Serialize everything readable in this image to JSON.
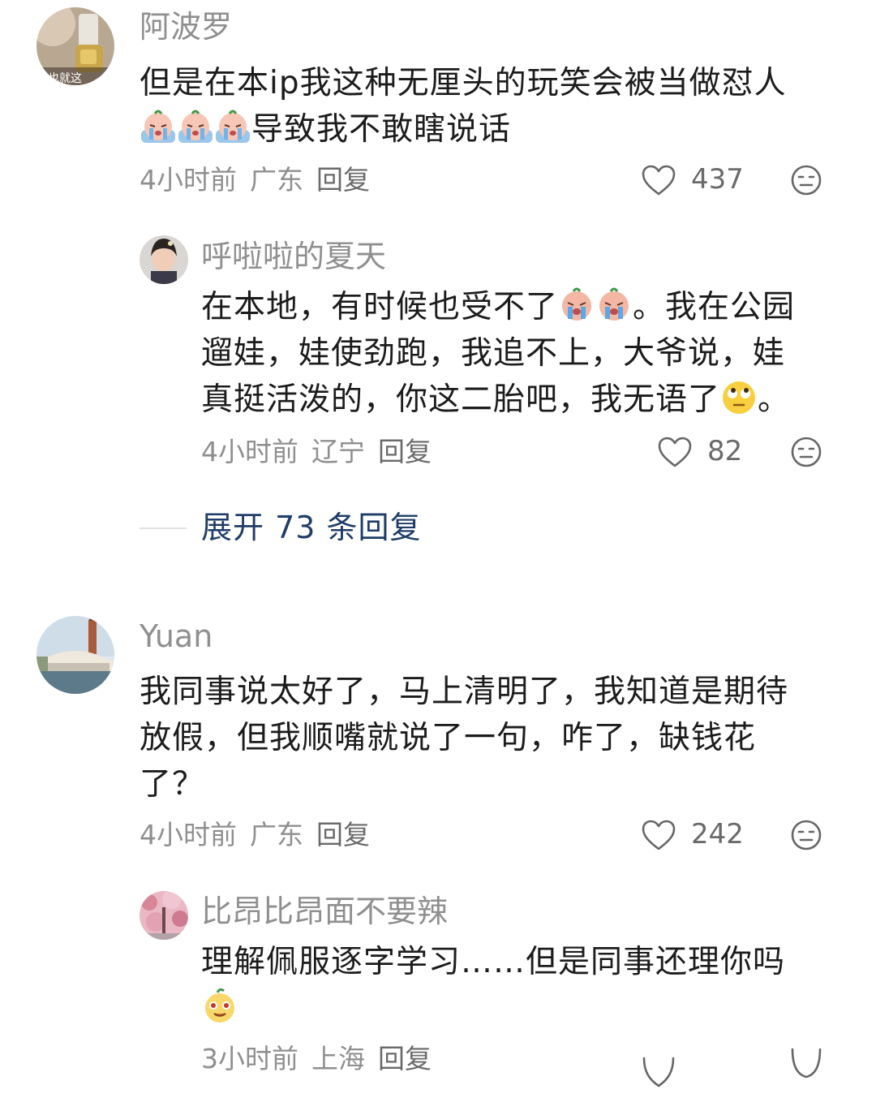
{
  "comments": [
    {
      "username": "阿波罗",
      "avatar_text": "也就这",
      "content_line1": "但是在本ip我这种无厘头的玩笑会被当做怼人",
      "content_line2": "导致我不敢瞎说话",
      "time": "4小时前",
      "location": "广东",
      "reply_label": "回复",
      "likes": "437"
    },
    {
      "username": "呼啦啦的夏天",
      "content_line1a": "在本地，有时候也受不了",
      "content_line1b": "。我在公园",
      "content_line2": "遛娃，娃使劲跑，我追不上，大爷说，娃",
      "content_line3a": "真挺活泼的，你这二胎吧，我无语了",
      "content_line3b": "。",
      "time": "4小时前",
      "location": "辽宁",
      "reply_label": "回复",
      "likes": "82"
    },
    {
      "username": "Yuan",
      "content_line1": "我同事说太好了，马上清明了，我知道是期待",
      "content_line2": "放假，但我顺嘴就说了一句，咋了，缺钱花",
      "content_line3": "了？",
      "time": "4小时前",
      "location": "广东",
      "reply_label": "回复",
      "likes": "242"
    },
    {
      "username": "比昂比昂面不要辣",
      "content_line1": "理解佩服逐字学习……但是同事还理你吗",
      "time": "3小时前",
      "location": "上海",
      "reply_label": "回复"
    }
  ],
  "expand_replies": "展开 73 条回复",
  "icons": {
    "like": "heart-outline-icon",
    "dislike": "neutral-face-icon",
    "emoji_cry": "crying-emoji",
    "emoji_eyeroll": "eye-roll-emoji",
    "emoji_face": "peach-face-emoji"
  },
  "colors": {
    "username": "#8f8f8f",
    "text": "#1c1c1c",
    "expand_link": "#1f3d68"
  }
}
